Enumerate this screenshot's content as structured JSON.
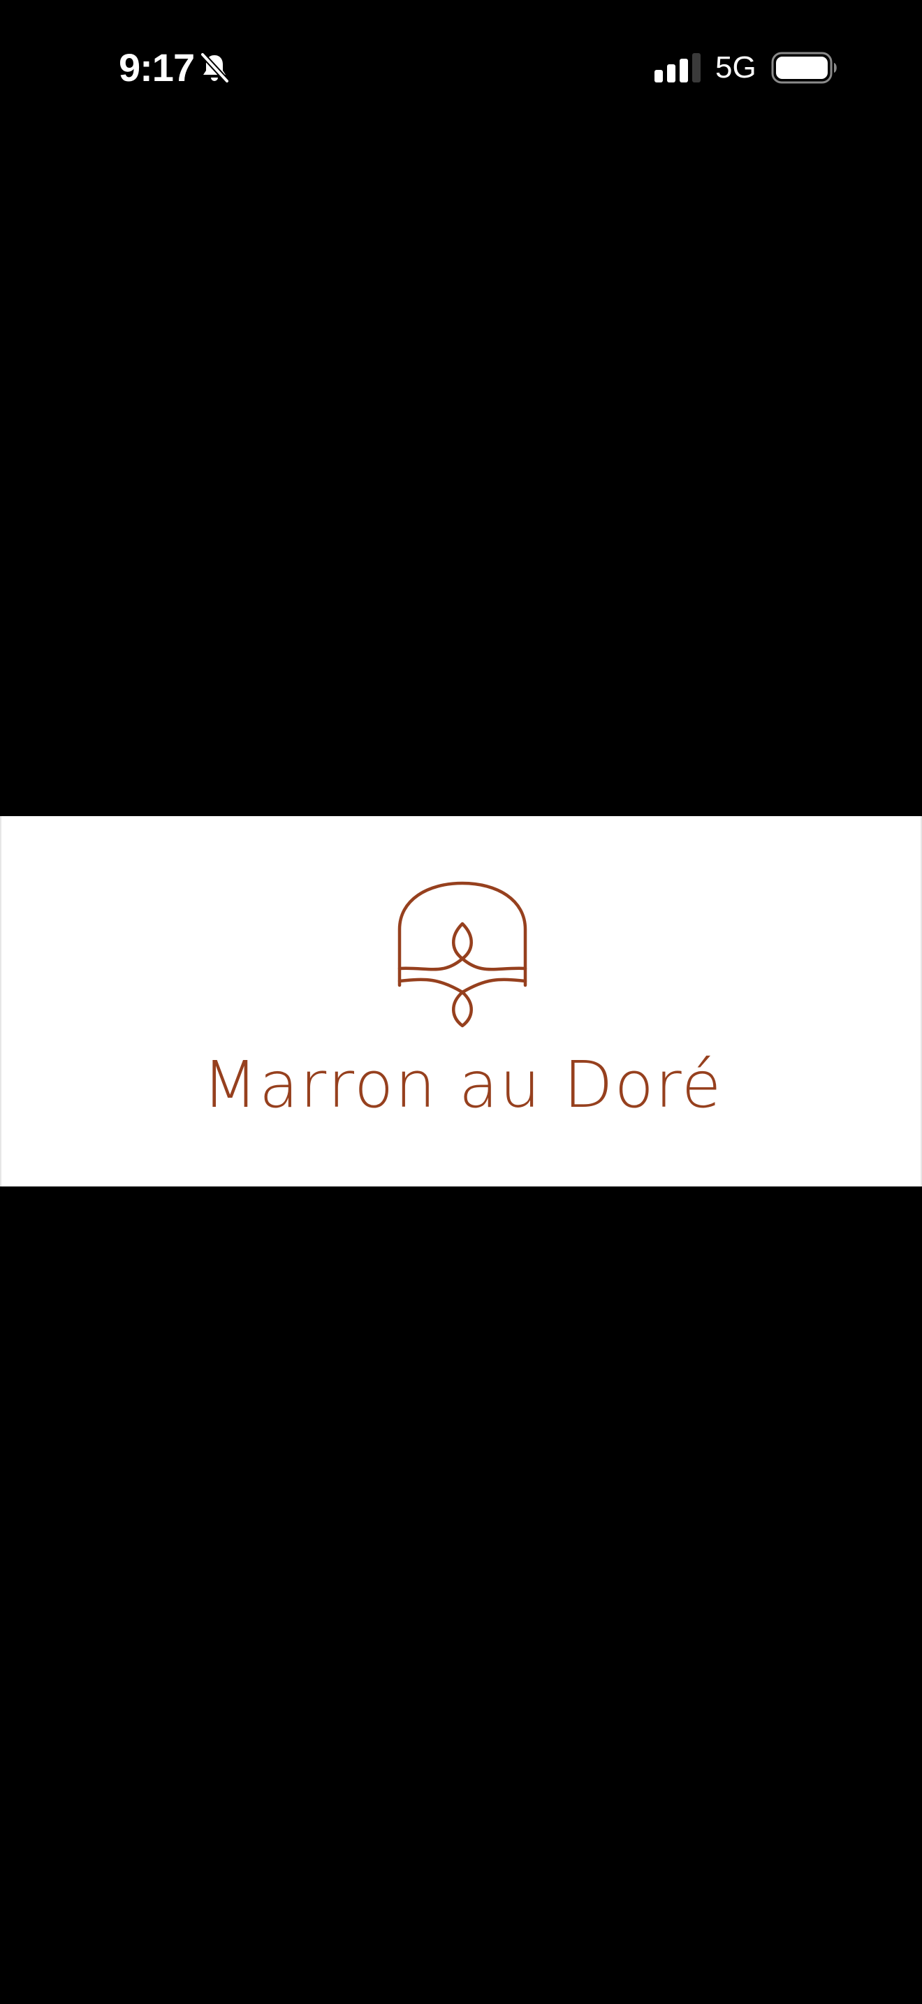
{
  "status_bar": {
    "time": "9:17",
    "network": "5G",
    "icons": {
      "mute": "bell-slash-icon",
      "signal": "cellular-signal-icon",
      "battery": "battery-icon"
    },
    "signal_bars_active": 3,
    "signal_bars_total": 4,
    "battery_level": 1.0
  },
  "logo": {
    "brand_name": "Marron au Doré",
    "emblem_icon": "arch-emblem-icon"
  },
  "colors": {
    "background": "#000000",
    "banner_background": "#ffffff",
    "brand": "#96401e",
    "status_text": "#ffffff"
  }
}
